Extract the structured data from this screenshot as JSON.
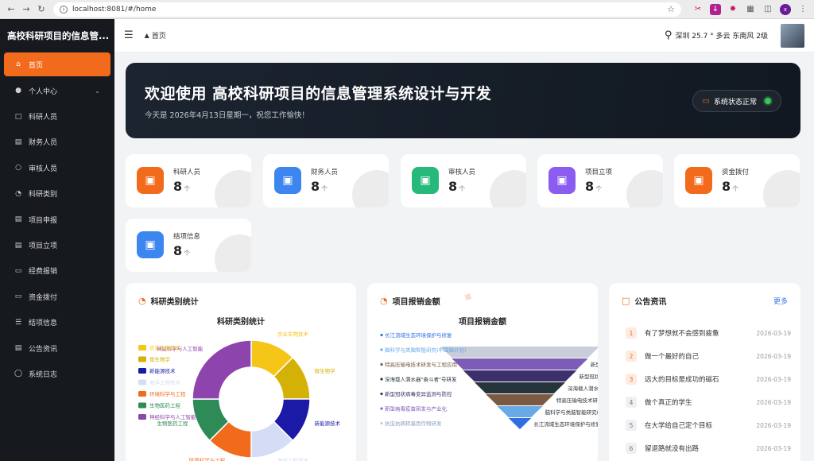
{
  "browser": {
    "url": "localhost:8081/#/home"
  },
  "sidebar": {
    "brand": "高校科研项目的信息管...",
    "items": [
      {
        "label": "首页",
        "icon": "home-icon",
        "active": true
      },
      {
        "label": "个人中心",
        "icon": "user-icon",
        "has_children": true
      },
      {
        "label": "科研人员",
        "icon": "file-icon"
      },
      {
        "label": "财务人员",
        "icon": "wallet-icon"
      },
      {
        "label": "审核人员",
        "icon": "chat-icon"
      },
      {
        "label": "科研类别",
        "icon": "pie-icon"
      },
      {
        "label": "项目申报",
        "icon": "doc-icon"
      },
      {
        "label": "项目立项",
        "icon": "doc-icon"
      },
      {
        "label": "经费报销",
        "icon": "receipt-icon"
      },
      {
        "label": "资金拨付",
        "icon": "monitor-icon"
      },
      {
        "label": "结项信息",
        "icon": "list-icon"
      },
      {
        "label": "公告资讯",
        "icon": "notice-icon"
      },
      {
        "label": "系统日志",
        "icon": "database-icon"
      }
    ]
  },
  "topbar": {
    "breadcrumb": "首页",
    "weather": "深圳 25.7 ° 多云 东南风 2级"
  },
  "banner": {
    "title": "欢迎使用 高校科研项目的信息管理系统设计与开发",
    "subtitle": "今天是 2026年4月13日星期一，祝您工作愉快！",
    "status": "系统状态正常"
  },
  "stats": [
    {
      "label": "科研人员",
      "value": "8",
      "unit": "个",
      "color": "#f26b1d"
    },
    {
      "label": "财务人员",
      "value": "8",
      "unit": "个",
      "color": "#3d86f0"
    },
    {
      "label": "审核人员",
      "value": "8",
      "unit": "个",
      "color": "#25b97b"
    },
    {
      "label": "项目立项",
      "value": "8",
      "unit": "个",
      "color": "#8a5cf0"
    },
    {
      "label": "资金拨付",
      "value": "8",
      "unit": "个",
      "color": "#f26b1d"
    },
    {
      "label": "结项信息",
      "value": "8",
      "unit": "个",
      "color": "#3d86f0"
    }
  ],
  "panels": {
    "category_title": "科研类别统计",
    "expense_title": "项目报销金额",
    "notice_title": "公告资讯",
    "notice_more": "更多"
  },
  "chart_data": [
    {
      "type": "pie",
      "title": "科研类别统计",
      "legend_position": "left",
      "categories": [
        "农业生物技术",
        "微生物学",
        "新能源技术",
        "海洋工程技术",
        "环境科学与工程",
        "生物医药工程",
        "神经科学与人工智能"
      ],
      "values": [
        1,
        1,
        1,
        1,
        1,
        1,
        2
      ],
      "colors": [
        "#f5c518",
        "#d4b106",
        "#1a1aa6",
        "#d4ddf5",
        "#f26b1d",
        "#2e8b57",
        "#8e44ad"
      ]
    },
    {
      "type": "funnel",
      "title": "项目报销金额",
      "legend_position": "left",
      "categories": [
        "抗虫抗病转基因作物研发",
        "新型病毒疫苗研发与产业化",
        "新型冠状病毒变异监测与防控",
        "深海载人潜水器\"奋斗者\"号研发",
        "特高压输电技术研发与工程应用",
        "脑科学与类脑智能研究(中国脑计划)",
        "长江流域生态环境保护与修复"
      ],
      "values": [
        7,
        6,
        5,
        4,
        3,
        2,
        1
      ],
      "colors": [
        "#c8cfd9",
        "#7d5cb8",
        "#3c2f6b",
        "#26343c",
        "#7a5a43",
        "#6aa9e8",
        "#2f6fe0"
      ]
    }
  ],
  "notices": [
    {
      "no": "1",
      "text": "有了梦想就不会感到疲惫",
      "date": "2026-03-19"
    },
    {
      "no": "2",
      "text": "做一个最好的自己",
      "date": "2026-03-19"
    },
    {
      "no": "3",
      "text": "远大的目标是成功的磁石",
      "date": "2026-03-19"
    },
    {
      "no": "4",
      "text": "做个真正的学生",
      "date": "2026-03-19"
    },
    {
      "no": "5",
      "text": "在大学给自己定个目标",
      "date": "2026-03-19"
    },
    {
      "no": "6",
      "text": "留退路就没有出路",
      "date": "2026-03-19"
    }
  ]
}
